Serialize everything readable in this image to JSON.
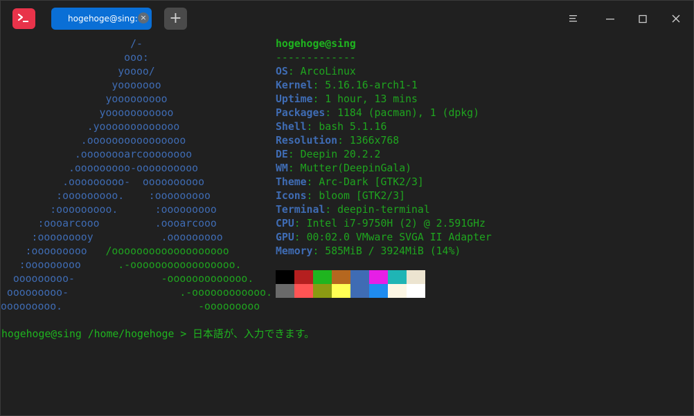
{
  "tab": {
    "title": "hogehoge@sing:~",
    "close_glyph": "×"
  },
  "new_tab_glyph": "+",
  "icons": {
    "app": "terminal-app-icon",
    "menu": "hamburger-menu-icon",
    "minimize": "minimize-icon",
    "maximize": "maximize-icon",
    "close": "close-icon"
  },
  "colors": {
    "background": "#202020",
    "accent_tab": "#0a6fd6",
    "app_icon": "#e8334a",
    "logo_blue": "#3f6cb4",
    "logo_green": "#1fa51f",
    "text_green": "#1fb51f"
  },
  "logo_lines": [
    {
      "blue": "                     /-",
      "green": ""
    },
    {
      "blue": "                    ooo:",
      "green": ""
    },
    {
      "blue": "                   yoooo/",
      "green": ""
    },
    {
      "blue": "                  yooooooo",
      "green": ""
    },
    {
      "blue": "                 yooooooooo",
      "green": ""
    },
    {
      "blue": "                yooooooooooo",
      "green": ""
    },
    {
      "blue": "              .yooooooooooooo",
      "green": ""
    },
    {
      "blue": "             .oooooooooooooooo",
      "green": ""
    },
    {
      "blue": "            .oooooooarcoooooooo",
      "green": ""
    },
    {
      "blue": "           .ooooooooo-oooooooooo",
      "green": ""
    },
    {
      "blue": "          .ooooooooo-  oooooooooo",
      "green": ""
    },
    {
      "blue": "         :ooooooooo.    :ooooooooo",
      "green": ""
    },
    {
      "blue": "        :ooooooooo.      :ooooooooo",
      "green": ""
    },
    {
      "blue": "      :oooarcooo         .oooarcooo",
      "green": ""
    },
    {
      "blue": "     :ooooooooy           .ooooooooo",
      "green": ""
    },
    {
      "blue": "    :ooooooooo   ",
      "green": "/ooooooooooooooooooo"
    },
    {
      "blue": "   :ooooooooo      ",
      "green": ".-ooooooooooooooooo."
    },
    {
      "blue": "  ooooooooo-              ",
      "green": "-ooooooooooooo."
    },
    {
      "blue": " ooooooooo-                  ",
      "green": ".-oooooooooooo."
    },
    {
      "blue": "ooooooooo.                      ",
      "green": "-ooooooooo"
    }
  ],
  "info": {
    "header": "hogehoge@sing",
    "separator": "-------------",
    "rows": [
      {
        "key": "OS",
        "value": "ArcoLinux"
      },
      {
        "key": "Kernel",
        "value": "5.16.16-arch1-1"
      },
      {
        "key": "Uptime",
        "value": "1 hour, 13 mins"
      },
      {
        "key": "Packages",
        "value": "1184 (pacman), 1 (dpkg)"
      },
      {
        "key": "Shell",
        "value": "bash 5.1.16"
      },
      {
        "key": "Resolution",
        "value": "1366x768"
      },
      {
        "key": "DE",
        "value": "Deepin 20.2.2"
      },
      {
        "key": "WM",
        "value": "Mutter(DeepinGala)"
      },
      {
        "key": "Theme",
        "value": "Arc-Dark [GTK2/3]"
      },
      {
        "key": "Icons",
        "value": "bloom [GTK2/3]"
      },
      {
        "key": "Terminal",
        "value": "deepin-terminal"
      },
      {
        "key": "CPU",
        "value": "Intel i7-9750H (2) @ 2.591GHz"
      },
      {
        "key": "GPU",
        "value": "00:02.0 VMware SVGA II Adapter"
      },
      {
        "key": "Memory",
        "value": "585MiB / 3924MiB (14%)"
      }
    ]
  },
  "palette": {
    "row1": [
      "#000000",
      "#b51f1f",
      "#1fb51f",
      "#b5671f",
      "#3f6cb4",
      "#e61fe6",
      "#1fb5b5",
      "#ece4d0"
    ],
    "row2": [
      "#6a6a6a",
      "#ff5454",
      "#8a9a12",
      "#ffff54",
      "#3f6cb4",
      "#1f8cf0",
      "#fcf6e4",
      "#ffffff"
    ]
  },
  "prompt": {
    "text": "hogehoge@sing /home/hogehoge > 日本語が、入力できます。"
  }
}
